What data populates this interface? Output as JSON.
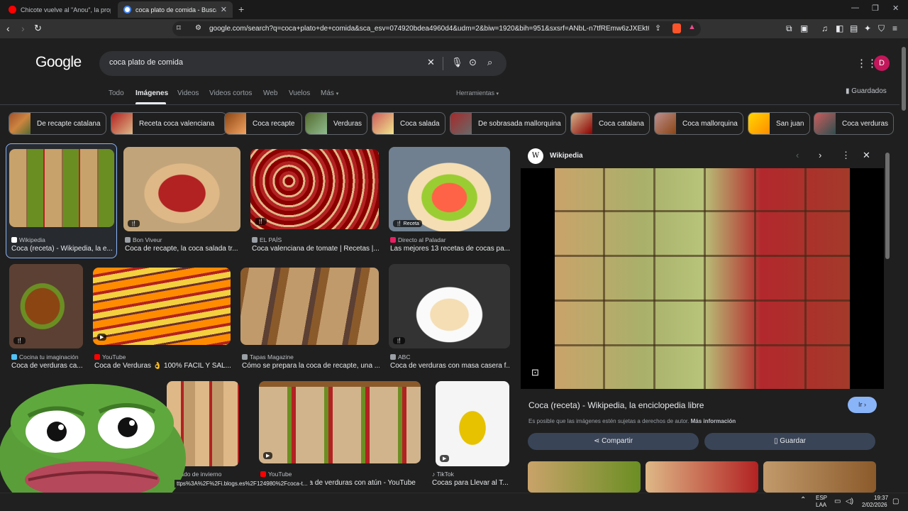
{
  "browser": {
    "tabs": [
      {
        "title": "Chicote vuelve al \"Anou\", la propietaria",
        "favicon_color": "#ff0000"
      },
      {
        "title": "coca plato de comida - Buscar con",
        "favicon_color": "#4285f4"
      }
    ],
    "url": "google.com/search?q=coca+plato+de+comida&sca_esv=074920bdea4960d4&udm=2&biw=1920&bih=951&sxsrf=ANbL-n7tfREmw6zJXEkt6qqng9..."
  },
  "google": {
    "logo": "Google",
    "query": "coca plato de comida",
    "avatar_letter": "D",
    "tabs": [
      "Todo",
      "Imágenes",
      "Videos",
      "Videos cortos",
      "Web",
      "Vuelos",
      "Más"
    ],
    "active_tab": "Imágenes",
    "tools_label": "Herramientas",
    "saved_label": "Guardados"
  },
  "chips": [
    "De recapte catalana",
    "Receta coca valenciana",
    "Coca recapte",
    "Verduras",
    "Coca salada",
    "De sobrasada mallorquina",
    "Coca catalana",
    "Coca mallorquina",
    "San juan",
    "Coca verduras"
  ],
  "results": [
    {
      "source": "Wikipedia",
      "caption": "Coca (receta) - Wikipedia, la e..."
    },
    {
      "source": "Bon Viveur",
      "caption": "Coca de recapte, la coca salada tr..."
    },
    {
      "source": "EL PAÍS",
      "caption": "Coca valenciana de tomate | Recetas |..."
    },
    {
      "source": "Directo al Paladar",
      "caption": "Las mejores 13 recetas de cocas pa...",
      "badge": "Receta"
    },
    {
      "source": "Cocina tu imaginación",
      "caption": "Coca de verduras ca..."
    },
    {
      "source": "YouTube",
      "caption": "Coca de Verduras 👌 100% FACIL Y SAL..."
    },
    {
      "source": "Tapas Magazine",
      "caption": "Cómo se prepara la coca de recapte, una ..."
    },
    {
      "source": "ABC",
      "caption": "Coca de verduras con masa casera f..."
    },
    {
      "source": "itado de invierno",
      "caption": ""
    },
    {
      "source": "YouTube",
      "caption": "oca de verduras con atún - YouTube"
    },
    {
      "source": "TikTok",
      "caption": "Cocas para Llevar al T..."
    }
  ],
  "panel": {
    "site": "Wikipedia",
    "title": "Coca (receta) - Wikipedia, la enciclopedia libre",
    "go_label": "Ir",
    "note": "Es posible que las imágenes estén sujetas a derechos de autor.",
    "note_link": "Más información",
    "share_label": "Compartir",
    "save_label": "Guardar"
  },
  "status_url": "ttps%3A%2F%2Fi.blogs.es%2F124980%2Fcoca-t...",
  "taskbar": {
    "lang": "ESP",
    "lang2": "LAA",
    "time": "19:37",
    "date": "2/02/2026"
  }
}
